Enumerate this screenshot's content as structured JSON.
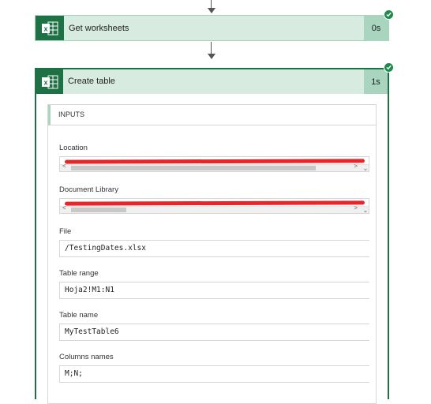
{
  "steps": [
    {
      "title": "Get worksheets",
      "duration": "0s",
      "status": "success",
      "icon": "excel-icon"
    },
    {
      "title": "Create table",
      "duration": "1s",
      "status": "success",
      "icon": "excel-icon"
    }
  ],
  "inputs": {
    "title": "INPUTS",
    "fields": [
      {
        "label": "Location",
        "value": "",
        "redacted": true
      },
      {
        "label": "Document Library",
        "value": "",
        "redacted": true
      },
      {
        "label": "File",
        "value": "/TestingDates.xlsx"
      },
      {
        "label": "Table range",
        "value": "Hoja2!M1:N1"
      },
      {
        "label": "Table name",
        "value": "MyTestTable6"
      },
      {
        "label": "Columns names",
        "value": "M;N;"
      }
    ]
  },
  "colors": {
    "excel_green": "#1e7145",
    "card_bg": "#d8ebe0",
    "success_badge": "#1f8a4c",
    "redaction": "#e8262a"
  }
}
